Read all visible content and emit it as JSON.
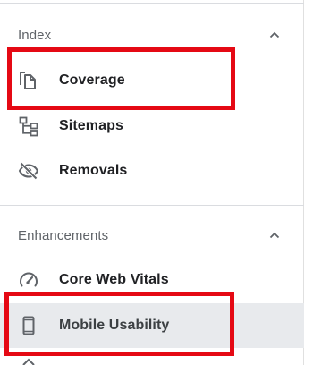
{
  "sections": {
    "index": {
      "title": "Index",
      "items": [
        {
          "label": "Coverage",
          "icon": "coverage-icon"
        },
        {
          "label": "Sitemaps",
          "icon": "sitemap-icon"
        },
        {
          "label": "Removals",
          "icon": "visibility-off-icon"
        }
      ]
    },
    "enhancements": {
      "title": "Enhancements",
      "items": [
        {
          "label": "Core Web Vitals",
          "icon": "speed-gauge-icon"
        },
        {
          "label": "Mobile Usability",
          "icon": "smartphone-icon"
        }
      ]
    }
  },
  "colors": {
    "icon": "#5f6368",
    "selected_background": "#e8eaed",
    "annotation_box": "#e50914"
  }
}
